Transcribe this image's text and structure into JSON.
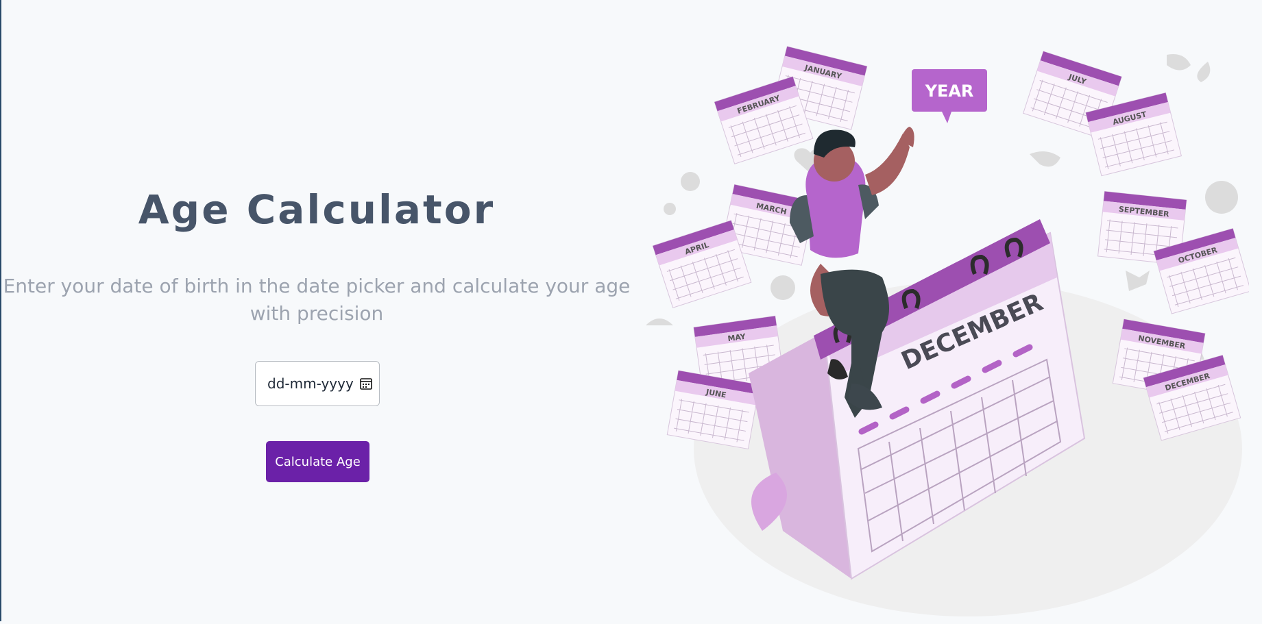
{
  "page": {
    "title": "Age Calculator",
    "subtitle": "Enter your date of birth in the date picker and calculate your age with precision"
  },
  "form": {
    "date_placeholder": "dd-mm-yyyy",
    "button_label": "Calculate Age"
  },
  "illustration": {
    "speech_bubble": "YEAR",
    "big_calendar_label": "DECEMBER",
    "months": [
      "JANUARY",
      "FEBRUARY",
      "MARCH",
      "APRIL",
      "MAY",
      "JUNE",
      "JULY",
      "AUGUST",
      "SEPTEMBER",
      "OCTOBER",
      "NOVEMBER",
      "DECEMBER"
    ]
  },
  "colors": {
    "accent": "#6b21a8",
    "title": "#475569",
    "subtitle": "#9ca3af",
    "calendar_purple": "#9d4fb0",
    "calendar_light": "#e9c9ee"
  }
}
